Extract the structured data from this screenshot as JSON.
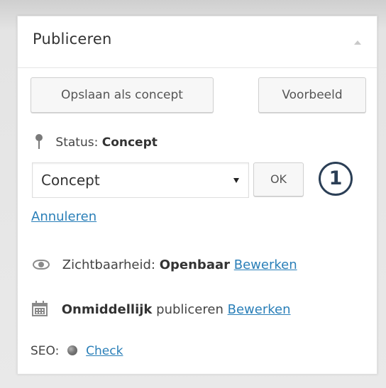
{
  "panel": {
    "title": "Publiceren"
  },
  "actions": {
    "save_draft_label": "Opslaan als concept",
    "preview_label": "Voorbeeld"
  },
  "status": {
    "label": "Status:",
    "value": "Concept",
    "select_value": "Concept",
    "ok_label": "OK",
    "cancel_label": "Annuleren",
    "step_badge": "1"
  },
  "visibility": {
    "label": "Zichtbaarheid:",
    "value": "Openbaar",
    "edit_label": "Bewerken"
  },
  "schedule": {
    "value": "Onmiddellijk",
    "label": "publiceren",
    "edit_label": "Bewerken"
  },
  "seo": {
    "label": "SEO:",
    "check_label": "Check"
  },
  "icons": {
    "status": "pin-icon",
    "visibility": "eye-icon",
    "schedule": "calendar-icon",
    "seo": "seo-status-dot",
    "collapse": "collapse-up-icon"
  }
}
